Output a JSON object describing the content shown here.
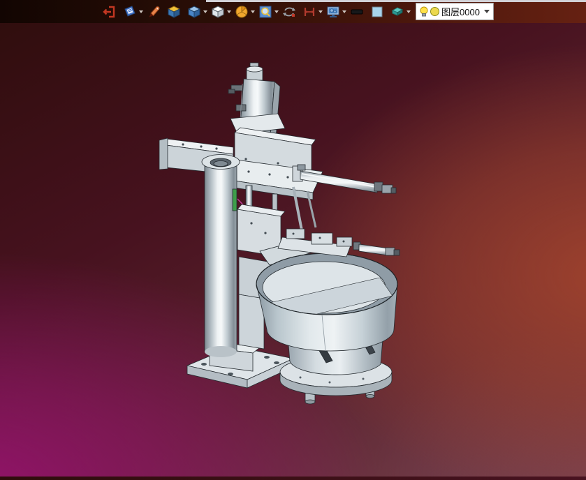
{
  "toolbar": {
    "icons": [
      {
        "name": "exit-icon",
        "dropdown": false
      },
      {
        "name": "sketch-book-icon",
        "dropdown": true
      },
      {
        "name": "brush-icon",
        "dropdown": false
      },
      {
        "name": "solid-color-box-icon",
        "dropdown": false
      },
      {
        "name": "shaded-cube-icon",
        "dropdown": true
      },
      {
        "name": "wireframe-cube-icon",
        "dropdown": true
      },
      {
        "name": "section-pie-icon",
        "dropdown": true
      },
      {
        "name": "zoom-window-icon",
        "dropdown": true
      },
      {
        "name": "rotate-view-icon",
        "dropdown": false
      },
      {
        "name": "dimension-icon",
        "dropdown": true
      },
      {
        "name": "display-settings-icon",
        "dropdown": true
      },
      {
        "name": "line-width-icon",
        "dropdown": false
      },
      {
        "name": "color-swatch-icon",
        "dropdown": false
      },
      {
        "name": "layer-tool-icon",
        "dropdown": true
      }
    ],
    "layer_combo": {
      "value": "图层0000",
      "bulb_icon": "layer-visibility-bulb-icon",
      "dot_icon": "layer-color-dot-icon"
    }
  },
  "viewport": {
    "model": "vibratory-bowl-feeder-machine-assembly",
    "colors": {
      "background_top_left": "#330e0d",
      "background_left_mid": "#4b1036",
      "background_bottom_left": "#8a1766",
      "background_right_mid": "#8e3a2a",
      "background_bottom_right": "#7a4149",
      "metal_light": "#eef2f4",
      "metal_mid": "#d7dde2",
      "metal_dark": "#8d98a0",
      "outline": "#23292e",
      "accent_green": "#3e9e4a",
      "accent_magenta": "#c53a9e"
    }
  }
}
